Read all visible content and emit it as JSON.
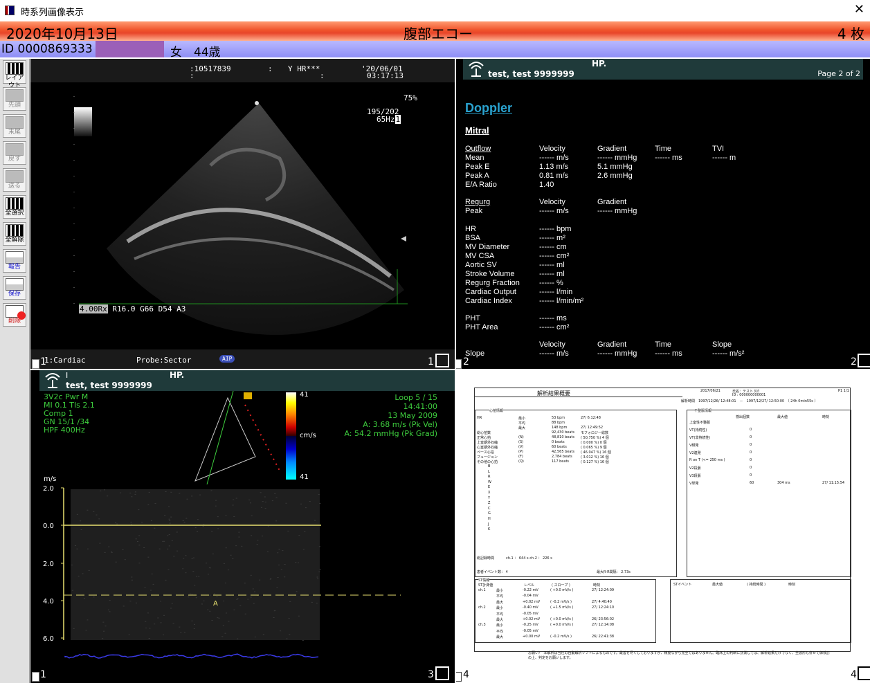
{
  "window": {
    "title": "時系列画像表示",
    "close_glyph": "✕"
  },
  "header": {
    "date": "2020年10月13日",
    "exam": "腹部エコー",
    "count": "4 枚"
  },
  "patient": {
    "id": "ID 0000869333",
    "sex_age": "女　44歳"
  },
  "toolbar": [
    {
      "label": "レイアウト",
      "icon": "layout-grid-icon",
      "state": "active"
    },
    {
      "label": "先頭",
      "icon": "first-icon",
      "state": "disabled"
    },
    {
      "label": "末尾",
      "icon": "last-icon",
      "state": "disabled"
    },
    {
      "label": "戻す",
      "icon": "prev-icon",
      "state": "disabled"
    },
    {
      "label": "送る",
      "icon": "next-icon",
      "state": "disabled"
    },
    {
      "label": "全選択",
      "icon": "select-all-icon",
      "state": "active"
    },
    {
      "label": "全解除",
      "icon": "deselect-all-icon",
      "state": "active"
    },
    {
      "label": "報告",
      "icon": "report-icon",
      "state": "blue"
    },
    {
      "label": "保存",
      "icon": "save-icon",
      "state": "blue"
    },
    {
      "label": "削除",
      "icon": "delete-icon",
      "state": "red"
    }
  ],
  "q1": {
    "line1a": ":10517839",
    "line1b": ":",
    "line1c": "Y HR***",
    "line1d": "'20/06/01",
    "line2a": ":",
    "line2b": ":",
    "line2c": "03:17:13",
    "gain": "75%",
    "frame": "195/202",
    "fps": "65Hz",
    "fps_box": "1",
    "params_box": "4.00Rx",
    "params": "R16.0 G66 D54 A3",
    "mode": "1:Cardiac",
    "probe": "Probe:Sector",
    "badge": "AIP",
    "num_left": "1",
    "num_right": "1"
  },
  "q2": {
    "name": "test, test 9999999",
    "hp": "HP.",
    "page": "Page 2 of 2",
    "title": "Doppler",
    "section": "Mitral",
    "outflow": {
      "label": "Outflow",
      "cols": [
        "Velocity",
        "Gradient",
        "Time",
        "TVI"
      ],
      "rows": [
        {
          "k": "Mean",
          "v": "------ m/s",
          "g": "------ mmHg",
          "t": "------ ms",
          "tvi": "------ m"
        },
        {
          "k": "Peak E",
          "v": "1.13 m/s",
          "g": "5.1 mmHg",
          "t": "",
          "tvi": ""
        },
        {
          "k": "Peak A",
          "v": "0.81 m/s",
          "g": "2.6 mmHg",
          "t": "",
          "tvi": ""
        },
        {
          "k": "E/A Ratio",
          "v": "1.40",
          "g": "",
          "t": "",
          "tvi": ""
        }
      ]
    },
    "regurg": {
      "label": "Regurg",
      "cols": [
        "Velocity",
        "Gradient"
      ],
      "rows": [
        {
          "k": "Peak",
          "v": "------ m/s",
          "g": "------ mmHg"
        }
      ]
    },
    "calc": [
      {
        "k": "HR",
        "v": "------ bpm"
      },
      {
        "k": "BSA",
        "v": "------ m²"
      },
      {
        "k": "MV Diameter",
        "v": "------ cm"
      },
      {
        "k": "MV CSA",
        "v": "------ cm²"
      },
      {
        "k": "Aortic SV",
        "v": "------ ml"
      },
      {
        "k": "Stroke Volume",
        "v": "------ ml"
      },
      {
        "k": "Regurg Fraction",
        "v": "------ %"
      },
      {
        "k": "Cardiac Output",
        "v": "------ l/min"
      },
      {
        "k": "Cardiac Index",
        "v": "------ l/min/m²"
      }
    ],
    "pht": [
      {
        "k": "PHT",
        "v": "------ ms"
      },
      {
        "k": "PHT Area",
        "v": "------ cm²"
      }
    ],
    "slope": {
      "cols": [
        "Velocity",
        "Gradient",
        "Time",
        "Slope"
      ],
      "row": {
        "k": "Slope",
        "v": "------ m/s",
        "g": "------ mmHg",
        "t": "------ ms",
        "s": "------ m/s²"
      }
    },
    "num_left": "2",
    "num_right": "2"
  },
  "q3": {
    "name": "test, test 9999999",
    "hp": "HP.",
    "id_mark": "I",
    "left_info": [
      "3V2c  Pwr M",
      "MI 0.1    TIs 2.1",
      "Comp 1",
      "GN  15/1  /34",
      "HPF  400Hz"
    ],
    "loop": "Loop 5 / 15",
    "time": "14:41:00",
    "date": "13 May 2009",
    "vel": "A: 3.68 m/s (Pk Vel)",
    "grad": "A: 54.2 mmHg (Pk Grad)",
    "scale_top": "41",
    "scale_unit": "cm/s",
    "scale_bot": "41",
    "y_unit": "m/s",
    "y_ticks": [
      "2.0",
      "0.0",
      "2.0",
      "4.0",
      "6.0"
    ],
    "cursor_label": "A",
    "num_left": "1",
    "num_right": "3"
  },
  "q4": {
    "title": "解析結果概要",
    "date": "2017/06/21",
    "patient_label": "氏名：テスト ﾀﾛｳ",
    "id_label": "ID : 000000000001",
    "page": "P1 1/1",
    "period": "解析時間　1997/12/26/ 12:48:01　－　1997/12/27/ 12:50:00　（ 24h 0min55s ）",
    "heart_title": "心拍情報",
    "heart_rows": [
      {
        "k": "HR",
        "s": "最小",
        "v": "53 bpm",
        "t": "27/  6:12:48"
      },
      {
        "k": "",
        "s": "平均",
        "v": "88 bpm",
        "t": ""
      },
      {
        "k": "",
        "s": "最大",
        "v": "148 bpm",
        "t": "27/ 12:49:52"
      },
      {
        "k": "総心拍数",
        "s": "",
        "v": "92,430 beats",
        "t": "モフォロジー総数"
      },
      {
        "k": "正常心拍",
        "s": "(N)",
        "v": "48,810 beats",
        "t": "( 50,750 %)   4 個"
      },
      {
        "k": "上室期外収縮",
        "s": "(S)",
        "v": "0 beats",
        "t": "(  0.000 %)   0 個"
      },
      {
        "k": "心室期外収縮",
        "s": "(V)",
        "v": "60 beats",
        "t": "(  0.065 %)   9 個"
      },
      {
        "k": "ペース心拍",
        "s": "(P)",
        "v": "42,565 beats",
        "t": "( 46.047 %)  16 個"
      },
      {
        "k": "フュージョン",
        "s": "(F)",
        "v": "2,784 beats",
        "t": "(  3.012 %)  16 個"
      },
      {
        "k": "その他の心拍",
        "s": "(Q)",
        "v": "117 beats",
        "t": "(  0.127 %)  16 個"
      }
    ],
    "extra_rows": [
      "B",
      "L",
      "R",
      "W",
      "E",
      "X",
      "Y",
      "Z",
      "C",
      "G",
      "H",
      "J",
      "K"
    ],
    "total_label": "総記録時間",
    "total_val": "ch.1 ：     644 s     ch.2 ：      226 s",
    "events_label": "患者イベント数：   4",
    "max_rr": "最大R-R間隔：    2.73s",
    "arr_title": "不整脈情報",
    "arr_cols": [
      "検出個数",
      "最大値",
      "時刻"
    ],
    "arr_rows": [
      {
        "k": "上室性不整脈",
        "a": "",
        "b": "",
        "c": ""
      },
      {
        "k": "VT(持続性)",
        "a": "0",
        "b": "",
        "c": ""
      },
      {
        "k": "VT(非持続性)",
        "a": "0",
        "b": "",
        "c": ""
      },
      {
        "k": "V頻発",
        "a": "0",
        "b": "",
        "c": ""
      },
      {
        "k": "V2連発",
        "a": "0",
        "b": "",
        "c": ""
      },
      {
        "k": "R on T (<= 250 ms )",
        "a": "0",
        "b": "",
        "c": ""
      },
      {
        "k": "V2段脈",
        "a": "0",
        "b": "",
        "c": ""
      },
      {
        "k": "V3段脈",
        "a": "0",
        "b": "",
        "c": ""
      },
      {
        "k": "V単発",
        "a": "60",
        "b": "304 ms",
        "c": "27/ 11:15:54"
      }
    ],
    "st_title": "ST情報",
    "st_cols": [
      "ST計測値",
      "レベル",
      "( スロープ )",
      "時刻"
    ],
    "st_rows": [
      {
        "ch": "ch.1",
        "s": "最小",
        "l": "-0.22 mV",
        "sl": "( +0.0 mV/s )",
        "t": "27/ 12:24:09"
      },
      {
        "ch": "",
        "s": "平均",
        "l": "-0.04 mV",
        "sl": "",
        "t": ""
      },
      {
        "ch": "",
        "s": "最大",
        "l": "+0.02 mV",
        "sl": "( -0.2 mV/s )",
        "t": "27/  4:40:40"
      },
      {
        "ch": "ch.2",
        "s": "最小",
        "l": "-0.40 mV",
        "sl": "( +1.5 mV/s )",
        "t": "27/ 12:24:10"
      },
      {
        "ch": "",
        "s": "平均",
        "l": "-0.05 mV",
        "sl": "",
        "t": ""
      },
      {
        "ch": "",
        "s": "最大",
        "l": "+0.02 mV",
        "sl": "( +0.0 mV/s )",
        "t": "26/ 23:56:02"
      },
      {
        "ch": "ch.3",
        "s": "最小",
        "l": "-0.25 mV",
        "sl": "( +0.0 mV/s )",
        "t": "27/ 12:14:08"
      },
      {
        "ch": "",
        "s": "平均",
        "l": "-0.05 mV",
        "sl": "",
        "t": ""
      },
      {
        "ch": "",
        "s": "最大",
        "l": "+0.00 mV",
        "sl": "( -0.2 mV/s )",
        "t": "26/ 22:41:38"
      }
    ],
    "st_event_title": "STイベント",
    "st_event_cols": [
      "最大値",
      "( 持続時間 )",
      "時刻"
    ],
    "note": "お願い）　本解析は当社の自動解析ソフトによるものです。最善を尽くしておりますが、精度ながら完全ではありません。臨床上の判断に計測しては、解析結果だけでなく、全波形も併せて御検討の上、判定をお願いします。",
    "num_left": "4",
    "num_right": "4"
  }
}
